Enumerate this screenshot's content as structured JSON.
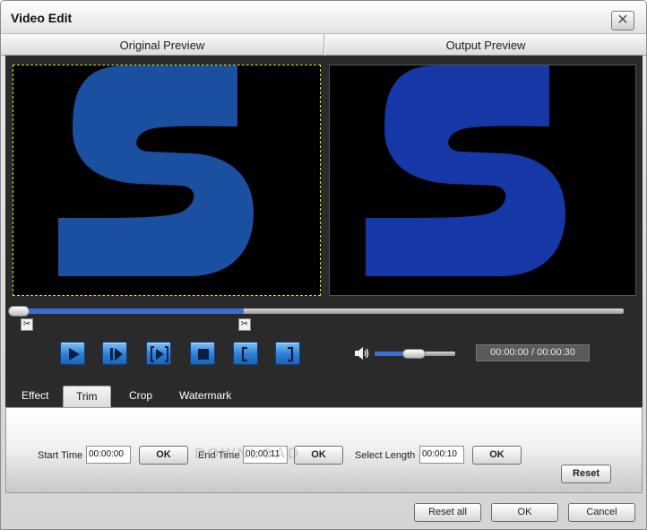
{
  "window": {
    "title": "Video Edit",
    "close_glyph": "✕"
  },
  "preview": {
    "original_label": "Original Preview",
    "output_label": "Output Preview",
    "logo_letter_color": "#1b4fa0",
    "output_letter_color": "#1637a6"
  },
  "playback": {
    "time_display": "00:00:00 / 00:00:30",
    "timeline_fill": 0.375,
    "volume_level": 0.35,
    "controls": [
      "play-icon",
      "step-forward-icon",
      "play-selection-icon",
      "stop-icon",
      "mark-in-icon",
      "mark-out-icon"
    ]
  },
  "tabs": [
    {
      "label": "Effect"
    },
    {
      "label": "Trim"
    },
    {
      "label": "Crop"
    },
    {
      "label": "Watermark"
    }
  ],
  "trim": {
    "start_label": "Start Time",
    "start_value": "00:00:00",
    "end_label": "End Time",
    "end_value": "00:00:11",
    "length_label": "Select Length",
    "length_value": "00:00:10",
    "ok_label": "OK",
    "reset_label": "Reset"
  },
  "footer": {
    "reset_all_label": "Reset all",
    "ok_label": "OK",
    "cancel_label": "Cancel"
  },
  "watermark_text": "DOWNLOAD"
}
